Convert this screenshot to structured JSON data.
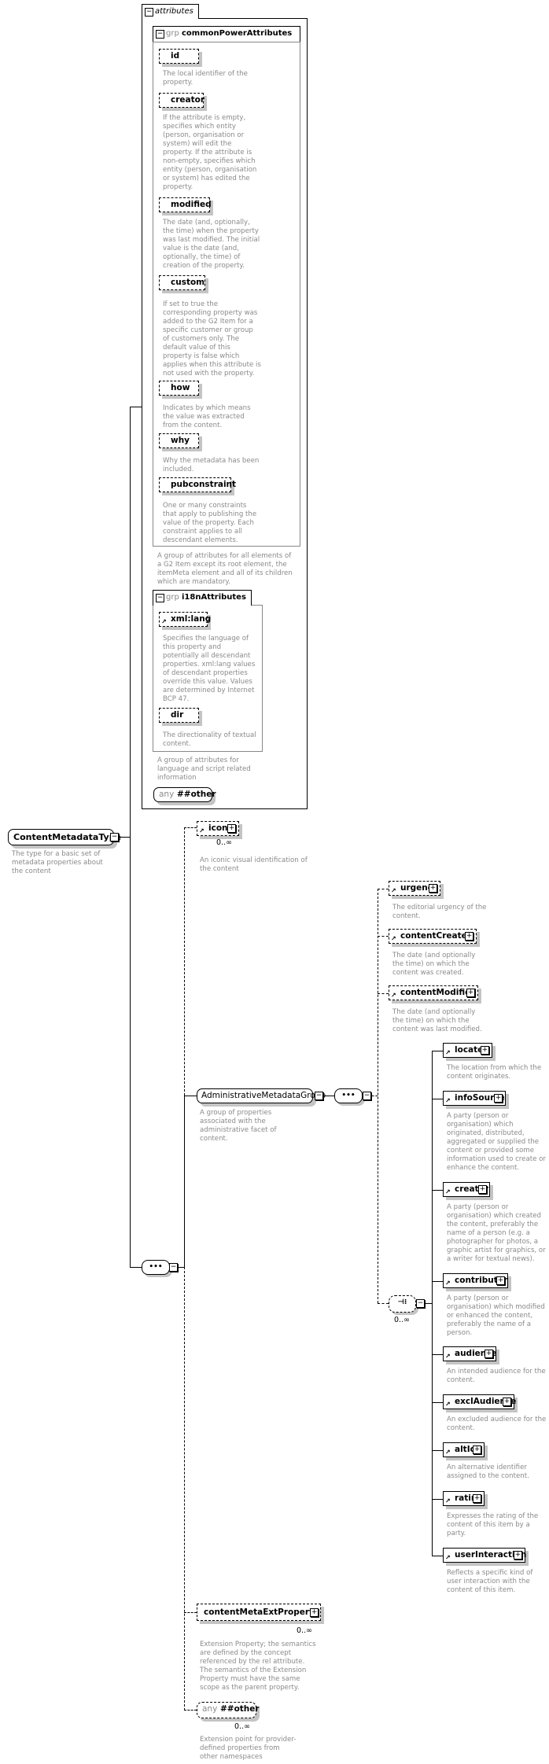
{
  "attributes": {
    "label": "attributes",
    "common_group": {
      "prefix": "grp",
      "name": "commonPowerAttributes",
      "items": [
        {
          "name": "id",
          "desc": "The local identifier of the property."
        },
        {
          "name": "creator",
          "desc": "If the attribute is empty, specifies which entity (person, organisation or system) will edit the property. If the attribute is non-empty, specifies which entity (person, organisation or system) has edited the property."
        },
        {
          "name": "modified",
          "desc": "The date (and, optionally, the time) when the property was last modified. The initial value is the date (and, optionally, the time) of creation of the property."
        },
        {
          "name": "custom",
          "desc": "If set to true the corresponding property was added to the G2 Item for a specific customer or group of customers only. The default value of this property is false which applies when this attribute is not used with the property."
        },
        {
          "name": "how",
          "desc": "Indicates by which means the value was extracted from the content."
        },
        {
          "name": "why",
          "desc": "Why the metadata has been included."
        },
        {
          "name": "pubconstraint",
          "desc": "One or many constraints that apply to publishing the value of the property. Each constraint applies to all descendant elements."
        }
      ],
      "desc": "A group of attributes for all elements of a G2 Item except its root element, the itemMeta element and all of its children which are mandatory."
    },
    "i18n_group": {
      "prefix": "grp",
      "name": "i18nAttributes",
      "items": [
        {
          "name": "xml:lang",
          "desc": "Specifies the language of this property and potentially all descendant properties. xml:lang values of descendant properties override this value. Values are determined by Internet BCP 47."
        },
        {
          "name": "dir",
          "desc": "The directionality of textual content."
        }
      ],
      "desc": "A group of attributes for language and script related information"
    },
    "any": {
      "prefix": "any",
      "name": "##other"
    }
  },
  "root": {
    "name": "ContentMetadataType",
    "desc": "The type for a  basic set of metadata properties about the content"
  },
  "icon_el": {
    "name": "icon",
    "occurs": "0..∞",
    "desc": "An iconic visual identification of the content"
  },
  "admin_group": {
    "name": "AdministrativeMetadataGroup",
    "desc": "A group of properties associated with the administrative facet of content."
  },
  "admin_seq": [
    {
      "name": "urgency",
      "desc": "The editorial urgency of the content."
    },
    {
      "name": "contentCreated",
      "desc": "The date (and optionally the time) on which the content was created."
    },
    {
      "name": "contentModified",
      "desc": "The date (and optionally the time) on which the content was last modified."
    }
  ],
  "choice_occurs": "0..∞",
  "choice_items": [
    {
      "name": "located",
      "desc": "The location from which the content originates."
    },
    {
      "name": "infoSource",
      "desc": "A party (person or organisation) which originated, distributed, aggregated or supplied the content or provided some information used to create or enhance the content."
    },
    {
      "name": "creator",
      "desc": "A party (person or organisation) which created the content, preferably the name of a person (e.g. a photographer for photos, a graphic artist for graphics, or a writer for textual news)."
    },
    {
      "name": "contributor",
      "desc": "A party (person or organisation) which modified or enhanced the content, preferably the name of a person."
    },
    {
      "name": "audience",
      "desc": "An intended audience for the content."
    },
    {
      "name": "exclAudience",
      "desc": "An excluded audience for the content."
    },
    {
      "name": "altId",
      "desc": "An alternative identifier assigned to the content."
    },
    {
      "name": "rating",
      "desc": "Expresses the rating of the content of this item by a party."
    },
    {
      "name": "userInteraction",
      "desc": "Reflects a specific kind of user interaction with the content of this item."
    }
  ],
  "ext_property": {
    "name": "contentMetaExtProperty",
    "occurs": "0..∞",
    "desc": "Extension Property; the semantics are defined by the concept referenced by the rel attribute. The semantics of the Extension Property must have the same scope as the parent property."
  },
  "any_other": {
    "prefix": "any",
    "name": "##other",
    "occurs": "0..∞",
    "desc": "Extension point for provider-defined properties from other namespaces"
  }
}
